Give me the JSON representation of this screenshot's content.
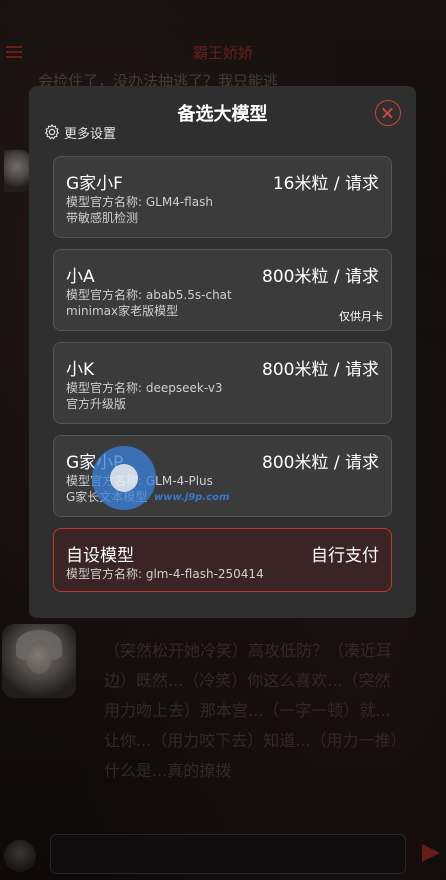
{
  "header": {
    "title": "霸王娇娇"
  },
  "background_line": "会捡住了，没办法抽逃了？我只能逃",
  "background_message": "（突然松开她冷笑）高攻低防？（凑近耳边）既然...（冷笑）你这么喜欢...（突然用力吻上去）那本宫...（一字一顿）就...让你...（用力咬下去）知道...（用力一推）什么是...真的撩拨",
  "modal": {
    "title": "备选大模型",
    "settings_label": "更多设置",
    "models": [
      {
        "name": "G家小F",
        "price": "16米粒 / 请求",
        "official": "模型官方名称:   GLM4-flash",
        "desc": "带敏感肌检测"
      },
      {
        "name": "小A",
        "price": "800米粒 / 请求",
        "official": "模型官方名称:   abab5.5s-chat",
        "desc": "minimax家老版模型",
        "badge": "仅供月卡"
      },
      {
        "name": "小K",
        "price": "800米粒 / 请求",
        "official": "模型官方名称:   deepseek-v3",
        "desc": "官方升级版"
      },
      {
        "name": "G家小P",
        "price": "800米粒 / 请求",
        "official": "模型官方名称:   GLM-4-Plus",
        "desc": "G家长文本模型"
      }
    ],
    "custom": {
      "name": "自设模型",
      "price": "自行支付",
      "official": "模型官方名称:   glm-4-flash-250414"
    }
  },
  "watermark": {
    "text": "www.j9p.com"
  },
  "colors": {
    "accent": "#c0392b",
    "modal_bg": "#2f2f30",
    "card_bg": "#3b3b3c"
  }
}
